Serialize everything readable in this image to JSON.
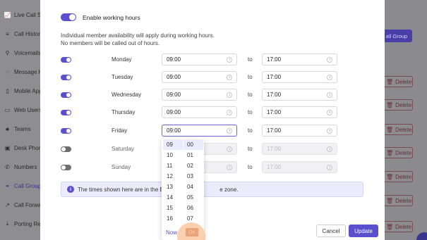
{
  "sidebar": {
    "items": [
      {
        "label": "Live Call St",
        "icon": "chart-icon"
      },
      {
        "label": "Call Histor",
        "icon": "list-icon"
      },
      {
        "label": "Voicemails",
        "icon": "voicemail-icon"
      },
      {
        "label": "Message H",
        "icon": "message-icon"
      },
      {
        "label": "Mobile App",
        "icon": "mobile-icon"
      },
      {
        "label": "Web Users",
        "icon": "monitor-icon"
      },
      {
        "label": "Teams",
        "icon": "team-icon"
      },
      {
        "label": "Desk Phon",
        "icon": "desk-phone-icon"
      },
      {
        "label": "Numbers",
        "icon": "phone-icon"
      },
      {
        "label": "Call Group",
        "icon": "group-icon"
      },
      {
        "label": "Call Forwa",
        "icon": "forward-icon"
      },
      {
        "label": "Porting Re",
        "icon": "porting-icon"
      }
    ]
  },
  "background": {
    "call_group_button": "all Group",
    "delete_label": "Delete"
  },
  "modal": {
    "enable_label": "Enable working hours",
    "enabled": true,
    "info_line1": "Individual member availability will apply during working hours.",
    "info_line2": "No members will be called out of hours.",
    "to_label": "to",
    "days": [
      {
        "name": "Monday",
        "enabled": true,
        "from": "09:00",
        "to": "17:00"
      },
      {
        "name": "Tuesday",
        "enabled": true,
        "from": "09:00",
        "to": "17:00"
      },
      {
        "name": "Wednesday",
        "enabled": true,
        "from": "09:00",
        "to": "17:00"
      },
      {
        "name": "Thursday",
        "enabled": true,
        "from": "09:00",
        "to": "17:00"
      },
      {
        "name": "Friday",
        "enabled": true,
        "from": "09:00",
        "to": "17:00"
      },
      {
        "name": "Saturday",
        "enabled": false,
        "from": "",
        "to": "17:00"
      },
      {
        "name": "Sunday",
        "enabled": false,
        "from": "",
        "to": "17:00"
      }
    ],
    "note_left": "The times shown here are in the Eu",
    "note_right": "e zone.",
    "cancel_label": "Cancel",
    "update_label": "Update"
  },
  "picker": {
    "hours": [
      "09",
      "10",
      "11",
      "12",
      "13",
      "14",
      "15",
      "16"
    ],
    "minutes": [
      "00",
      "01",
      "02",
      "03",
      "04",
      "05",
      "06",
      "07"
    ],
    "selected_hour": "09",
    "selected_minute": "00",
    "now_label": "Now",
    "ok_label": "OK"
  },
  "colors": {
    "accent": "#5a4fcf",
    "overlay": "#8a8a8e",
    "ok_button": "#d99a8e"
  }
}
